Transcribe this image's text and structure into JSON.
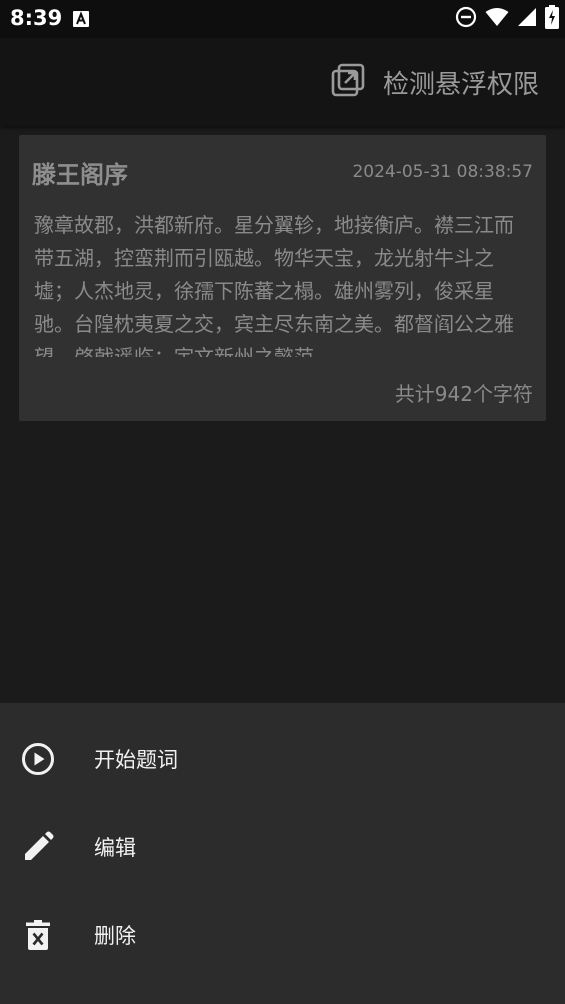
{
  "status_bar": {
    "time": "8:39",
    "icons": [
      "notification-a-icon",
      "do-not-disturb-icon",
      "wifi-icon",
      "cellular-signal-icon",
      "battery-icon"
    ]
  },
  "app_bar": {
    "action_label": "检测悬浮权限",
    "action_icon": "open-in-new-icon"
  },
  "card": {
    "title": "滕王阁序",
    "date": "2024-05-31 08:38:57",
    "body": "豫章故郡，洪都新府。星分翼轸，地接衡庐。襟三江而带五湖，控蛮荆而引瓯越。物华天宝，龙光射牛斗之墟；人杰地灵，徐孺下陈蕃之榻。雄州雾列，俊采星驰。台隍枕夷夏之交，宾主尽东南之美。都督阎公之雅望，棨戟遥临；宇文新州之懿范，",
    "char_count": "共计942个字符"
  },
  "sheet": {
    "items": [
      {
        "label": "开始题词",
        "icon": "play-circle-icon"
      },
      {
        "label": "编辑",
        "icon": "pencil-icon"
      },
      {
        "label": "删除",
        "icon": "delete-icon"
      }
    ]
  },
  "colors": {
    "background": "#1b1b1b",
    "card": "#313131",
    "sheet": "#2c2c2c",
    "text_dim": "#8a8a8a"
  }
}
